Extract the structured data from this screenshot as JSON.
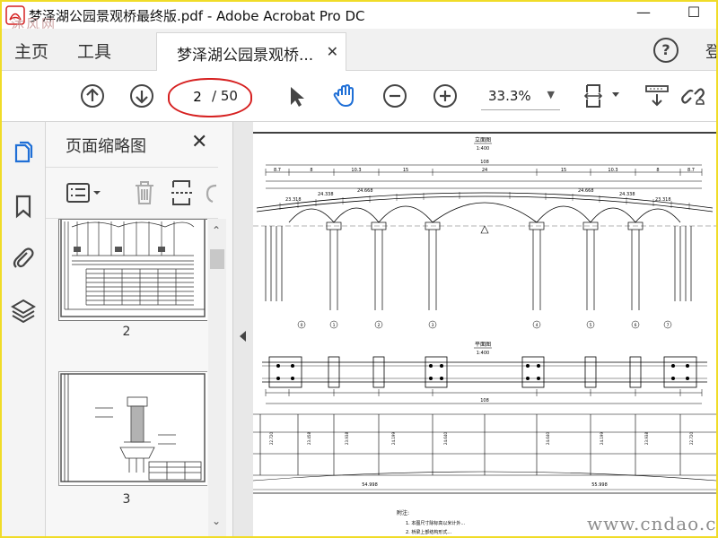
{
  "window": {
    "title": "梦泽湖公园景观桥最终版.pdf - Adobe Acrobat Pro DC",
    "watermark_tl": "沐风网",
    "minimize": "—",
    "maximize": "☐"
  },
  "menu": {
    "home": "主页",
    "tools": "工具",
    "doc_tab": "梦泽湖公园景观桥...",
    "tab_close": "✕",
    "help": "?",
    "edge_fragment": "登"
  },
  "toolbar": {
    "current_page": "2",
    "total_pages": "/ 50",
    "zoom": "33.3%",
    "icons": [
      "page-up-icon",
      "page-down-icon",
      "select-arrow-icon",
      "hand-tool-icon",
      "zoom-out-icon",
      "zoom-in-icon",
      "page-fit-icon",
      "scroll-mode-icon",
      "share-link-icon"
    ]
  },
  "panel": {
    "title": "页面缩略图",
    "close": "✕",
    "thumbnails": [
      {
        "page": "2"
      },
      {
        "page": "3"
      }
    ]
  },
  "drawing": {
    "elevation_title": "立面图",
    "elevation_scale": "1:400",
    "plan_title": "平面图",
    "plan_scale": "1:400",
    "notes_title": "附注:",
    "note_1": "1. 本图尺寸除标高以米计外...",
    "note_2": "2. 桥梁上部结构形式...",
    "span_labels": [
      "8.7",
      "8",
      "10.3",
      "15",
      "24",
      "15",
      "10.3",
      "8",
      "8.7"
    ],
    "total_length": "108",
    "elevations_left": [
      "23.318",
      "24.338",
      "24.668"
    ],
    "elevations_right": [
      "24.668",
      "24.338",
      "23.318"
    ],
    "pier_labels": [
      "0",
      "1",
      "2",
      "3",
      "4",
      "5",
      "6",
      "7"
    ],
    "profile_values": [
      "54.998",
      "55.998"
    ]
  },
  "watermark_br": "www.cndao.com",
  "colors": {
    "frame": "#f0dc28",
    "accent_blue": "#1f6fd6",
    "annotation_red": "#d62020"
  }
}
